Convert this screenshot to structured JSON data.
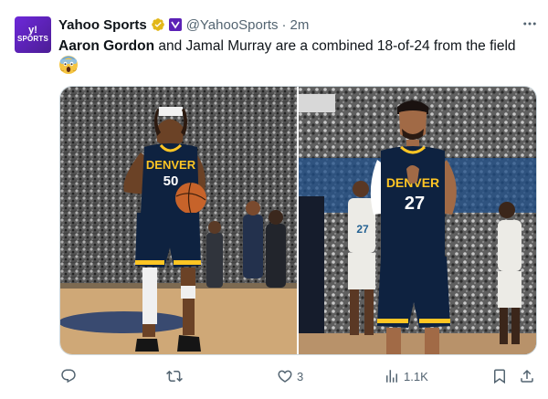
{
  "account": {
    "avatar_line1": "y!",
    "avatar_line2": "SPORTS",
    "display_name": "Yahoo Sports",
    "handle": "@YahooSports",
    "separator": "·",
    "time": "2m"
  },
  "tweet": {
    "text_bold": "Aaron Gordon",
    "text_rest": " and Jamal Murray are a combined 18-of-24 from the field",
    "emoji": "face-screaming-in-fear-emoji"
  },
  "media": {
    "left": {
      "jersey_team": "DENVER",
      "jersey_number": "50"
    },
    "right": {
      "jersey_team": "DENVER",
      "jersey_number": "27",
      "opponent_number": "27"
    }
  },
  "actions": {
    "reply_count": "",
    "retweet_count": "",
    "like_count": "3",
    "views_count": "1.1K"
  },
  "colors": {
    "brand_purple": "#6d28d9",
    "verified_gold": "#e2b719",
    "muted_text": "#536471",
    "nuggets_navy": "#0e2240",
    "nuggets_gold": "#fec524"
  }
}
